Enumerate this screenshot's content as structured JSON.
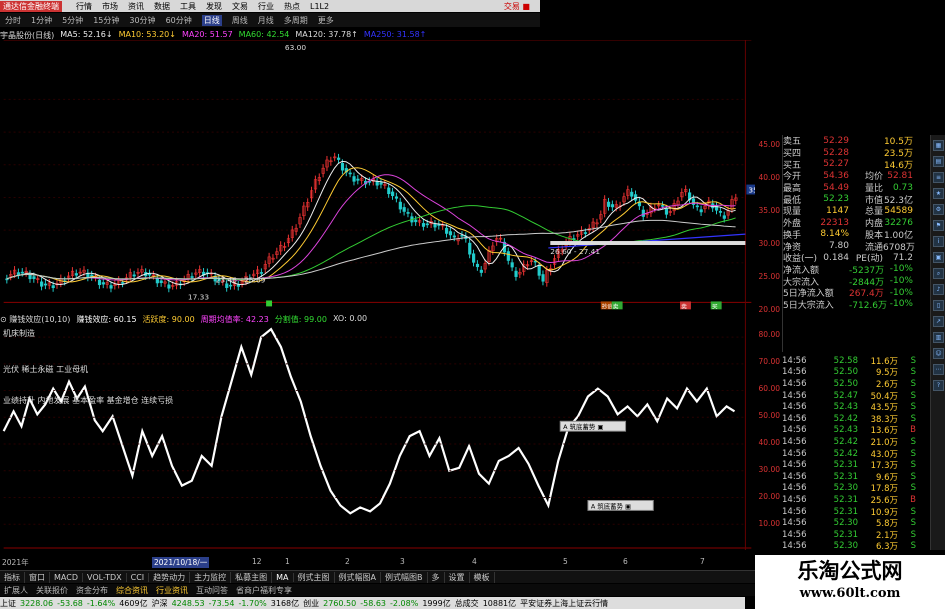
{
  "titlebar": {
    "app": "通达信金融终端",
    "menus": [
      "行情",
      "市场",
      "资讯",
      "数据",
      "工具",
      "发现",
      "文易",
      "行业",
      "热点"
    ],
    "code": "L1L2",
    "right": "交易 ■"
  },
  "periods": {
    "items": [
      "分时",
      "1分钟",
      "5分钟",
      "15分钟",
      "30分钟",
      "60分钟",
      "日线",
      "周线",
      "月线",
      "多周期",
      "更多"
    ],
    "active_index": 6
  },
  "ma_legend": [
    {
      "text": "宇晶股份(日线)",
      "color": "#ddd"
    },
    {
      "text": "MA5: 52.16↓",
      "color": "#eee"
    },
    {
      "text": "MA10: 53.20↓",
      "color": "#fc3"
    },
    {
      "text": "MA20: 51.57",
      "color": "#f4f"
    },
    {
      "text": "MA60: 42.54",
      "color": "#3d3"
    },
    {
      "text": "MA120: 37.78↑",
      "color": "#ddd"
    },
    {
      "text": "MA250: 31.58↑",
      "color": "#33f"
    }
  ],
  "price_annotations": {
    "high": "63.00",
    "low": "17.33",
    "range1": "23.46 - 25.69",
    "range2": "26.60 - 27.41",
    "current": "35.58"
  },
  "price_axis": [
    "45.00",
    "40.00",
    "35.00",
    "30.00",
    "25.00",
    "20.00"
  ],
  "indicator_legend": [
    {
      "text": "⊙ 赚钱效应(10,10)",
      "color": "#ddd"
    },
    {
      "text": "赚钱效应: 60.15",
      "color": "#fff"
    },
    {
      "text": "活跃度: 90.00",
      "color": "#fc3"
    },
    {
      "text": "周期均值率: 42.23",
      "color": "#f4f"
    },
    {
      "text": "分割值: 99.00",
      "color": "#3d3"
    },
    {
      "text": "XO: 0.00",
      "color": "#ddd"
    }
  ],
  "indicator_labels": [
    "机床制造",
    "光伏 稀土永磁 工业母机",
    "业绩持升 内地发展 基本盈率 基金增仓 连续亏损"
  ],
  "indicator_axis": [
    "80.00",
    "70.00",
    "60.00",
    "50.00",
    "40.00",
    "30.00",
    "20.00",
    "10.00"
  ],
  "signal_badges": [
    "抄底",
    "卖",
    "卖",
    "买"
  ],
  "popup_labels": [
    "A 筑底蓄势 ▣",
    "A 筑底蓄势 ▣"
  ],
  "quote": {
    "rows": [
      {
        "k": "卖五",
        "v1": "52.29",
        "k2": "",
        "v3": "10.5万",
        "c1": "#d33",
        "c3": "#fc3"
      },
      {
        "k": "买四",
        "v1": "52.28",
        "k2": "",
        "v3": "23.5万",
        "c1": "#d33",
        "c3": "#fc3"
      },
      {
        "k": "买五",
        "v1": "52.27",
        "k2": "",
        "v3": "14.6万",
        "c1": "#d33",
        "c3": "#fc3"
      },
      {
        "k": "今开",
        "v1": "54.36",
        "k2": "均价",
        "v3": "52.81",
        "c1": "#d33",
        "c3": "#d33"
      },
      {
        "k": "最高",
        "v1": "54.49",
        "k2": "量比",
        "v3": "0.73",
        "c1": "#d33",
        "c3": "#3c3"
      },
      {
        "k": "最低",
        "v1": "52.23",
        "k2": "市值",
        "v3": "52.3亿",
        "c1": "#3c3",
        "c3": "#ccc"
      },
      {
        "k": "现量",
        "v1": "1147",
        "k2": "总量",
        "v3": "54589",
        "c1": "#fc3",
        "c3": "#fc3"
      },
      {
        "k": "外盘",
        "v1": "22313",
        "k2": "内盘",
        "v3": "32276",
        "c1": "#d33",
        "c3": "#3c3"
      },
      {
        "k": "换手",
        "v1": "8.14%",
        "k2": "股本",
        "v3": "1.00亿",
        "c1": "#fc3",
        "c3": "#ccc"
      },
      {
        "k": "净资",
        "v1": "7.80",
        "k2": "流通",
        "v3": "6708万",
        "c1": "#ccc",
        "c3": "#ccc"
      },
      {
        "k": "收益(一)",
        "v1": "0.184",
        "k2": "PE(动)",
        "v3": "71.2",
        "c1": "#ccc",
        "c3": "#ccc"
      },
      {
        "k": "净流入额",
        "v1": "",
        "k2": "-5237万",
        "v3": "-10%",
        "c1": "#3c3",
        "c3": "#3c3"
      },
      {
        "k": "大宗流入",
        "v1": "",
        "k2": "-2844万",
        "v3": "-10%",
        "c1": "#3c3",
        "c3": "#3c3"
      },
      {
        "k": "5日净流入额",
        "v1": "",
        "k2": "267.4万",
        "v3": "-10%",
        "c1": "#d33",
        "c3": "#3c3"
      },
      {
        "k": "5日大宗流入",
        "v1": "",
        "k2": "-712.6万",
        "v3": "-10%",
        "c1": "#3c3",
        "c3": "#3c3"
      }
    ]
  },
  "ticks": [
    {
      "t": "14:56",
      "p": "52.58",
      "vol": "11.6万",
      "bs": "S",
      "bc": "#3c3"
    },
    {
      "t": "14:56",
      "p": "52.50",
      "vol": "9.5万",
      "bs": "S",
      "bc": "#3c3"
    },
    {
      "t": "14:56",
      "p": "52.50",
      "vol": "2.6万",
      "bs": "S",
      "bc": "#3c3"
    },
    {
      "t": "14:56",
      "p": "52.47",
      "vol": "50.4万",
      "bs": "S",
      "bc": "#3c3"
    },
    {
      "t": "14:56",
      "p": "52.43",
      "vol": "43.5万",
      "bs": "S",
      "bc": "#3c3"
    },
    {
      "t": "14:56",
      "p": "52.42",
      "vol": "38.3万",
      "bs": "S",
      "bc": "#3c3"
    },
    {
      "t": "14:56",
      "p": "52.43",
      "vol": "13.6万",
      "bs": "B",
      "bc": "#d33"
    },
    {
      "t": "14:56",
      "p": "52.42",
      "vol": "21.0万",
      "bs": "S",
      "bc": "#3c3"
    },
    {
      "t": "14:56",
      "p": "52.42",
      "vol": "43.0万",
      "bs": "S",
      "bc": "#3c3"
    },
    {
      "t": "14:56",
      "p": "52.31",
      "vol": "17.3万",
      "bs": "S",
      "bc": "#3c3"
    },
    {
      "t": "14:56",
      "p": "52.31",
      "vol": "9.6万",
      "bs": "S",
      "bc": "#3c3"
    },
    {
      "t": "14:56",
      "p": "52.30",
      "vol": "17.8万",
      "bs": "S",
      "bc": "#3c3"
    },
    {
      "t": "14:56",
      "p": "52.31",
      "vol": "25.6万",
      "bs": "B",
      "bc": "#d33"
    },
    {
      "t": "14:56",
      "p": "52.31",
      "vol": "10.9万",
      "bs": "S",
      "bc": "#3c3"
    },
    {
      "t": "14:56",
      "p": "52.30",
      "vol": "5.8万",
      "bs": "S",
      "bc": "#3c3"
    },
    {
      "t": "14:56",
      "p": "52.31",
      "vol": "2.1万",
      "bs": "S",
      "bc": "#3c3"
    },
    {
      "t": "14:56",
      "p": "52.30",
      "vol": "6.3万",
      "bs": "S",
      "bc": "#3c3"
    }
  ],
  "time_axis": {
    "labels": [
      "2021年",
      "2021/10/18/一",
      "12",
      "1",
      "2",
      "3",
      "4",
      "5",
      "6",
      "7"
    ],
    "highlight_index": 1
  },
  "bottom_tabs": [
    "指标",
    "窗口",
    "MACD",
    "VOL-TDX",
    "CCI",
    "趋势动力",
    "主力监控",
    "私募主图",
    "MA",
    "例式主图",
    "例式幅图A",
    "例式幅图B",
    "多",
    "设置",
    "模板"
  ],
  "section_tabs": [
    "扩展人",
    "关联报价",
    "资金分布",
    "综合资讯",
    "行业资讯",
    "互动问答",
    "省商户福利专享"
  ],
  "index_bar": [
    {
      "text": "上证",
      "color": "#000"
    },
    {
      "text": "3228.06",
      "color": "#080"
    },
    {
      "text": "-53.68",
      "color": "#080"
    },
    {
      "text": "-1.64%",
      "color": "#080"
    },
    {
      "text": "4609亿",
      "color": "#000"
    },
    {
      "text": "沪深",
      "color": "#000"
    },
    {
      "text": "4248.53",
      "color": "#080"
    },
    {
      "text": "-73.54",
      "color": "#080"
    },
    {
      "text": "-1.70%",
      "color": "#080"
    },
    {
      "text": "3168亿",
      "color": "#000"
    },
    {
      "text": "创业",
      "color": "#000"
    },
    {
      "text": "2760.50",
      "color": "#080"
    },
    {
      "text": "-58.63",
      "color": "#080"
    },
    {
      "text": "-2.08%",
      "color": "#080"
    },
    {
      "text": "1999亿",
      "color": "#000"
    },
    {
      "text": "总成交",
      "color": "#000"
    },
    {
      "text": "10881亿",
      "color": "#000"
    },
    {
      "text": "平安证券上海上证云行情",
      "color": "#000"
    }
  ],
  "watermark": {
    "cn": "乐淘公式网",
    "url": "www.60lt.com"
  },
  "colors": {
    "up": "#d33",
    "down": "#3c3",
    "accent": "#fc3",
    "background": "#000"
  }
}
